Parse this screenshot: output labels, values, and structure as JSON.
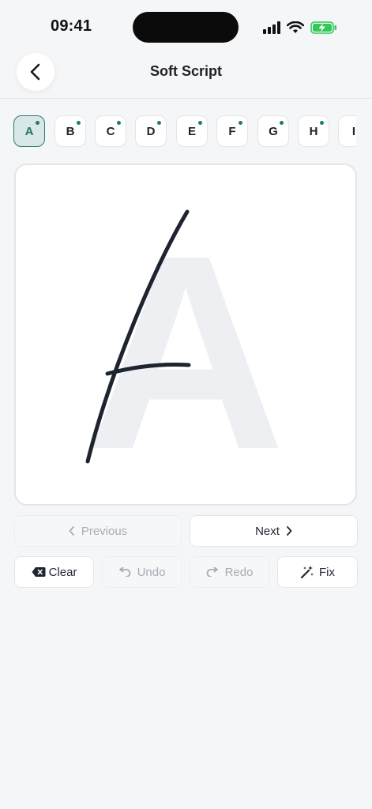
{
  "status_bar": {
    "time": "09:41"
  },
  "header": {
    "title": "Soft Script"
  },
  "letters": [
    {
      "label": "A",
      "active": true
    },
    {
      "label": "B"
    },
    {
      "label": "C"
    },
    {
      "label": "D"
    },
    {
      "label": "E"
    },
    {
      "label": "F"
    },
    {
      "label": "G"
    },
    {
      "label": "H"
    },
    {
      "label": "I"
    }
  ],
  "canvas": {
    "guide_letter": "A"
  },
  "nav": {
    "previous": "Previous",
    "next": "Next"
  },
  "tools": {
    "clear": "Clear",
    "undo": "Undo",
    "redo": "Redo",
    "fix": "Fix"
  },
  "colors": {
    "accent": "#2f7a72",
    "stroke": "#1d2430",
    "guide": "#eeeff2"
  }
}
